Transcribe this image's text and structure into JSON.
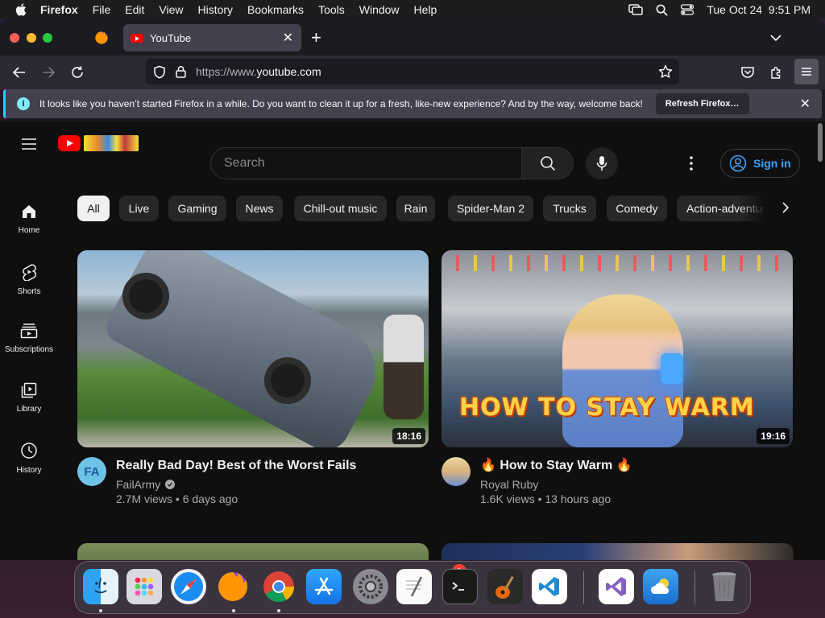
{
  "menubar": {
    "app": "Firefox",
    "items": [
      "File",
      "Edit",
      "View",
      "History",
      "Bookmarks",
      "Tools",
      "Window",
      "Help"
    ],
    "datetime": "Tue Oct 24  9:51 PM"
  },
  "browser": {
    "tab_title": "YouTube",
    "url_dim": "https://www.",
    "url_host": "youtube.com",
    "notification": {
      "message": "It looks like you haven’t started Firefox in a while. Do you want to clean it up for a fresh, like-new experience? And by the way, welcome back!",
      "button": "Refresh Firefox…"
    }
  },
  "youtube": {
    "search_placeholder": "Search",
    "sign_in": "Sign in",
    "guide": [
      {
        "label": "Home",
        "icon": "home-icon"
      },
      {
        "label": "Shorts",
        "icon": "shorts-icon"
      },
      {
        "label": "Subscriptions",
        "icon": "subscriptions-icon"
      },
      {
        "label": "Library",
        "icon": "library-icon"
      },
      {
        "label": "History",
        "icon": "history-icon"
      }
    ],
    "chips": [
      "All",
      "Live",
      "Gaming",
      "News",
      "Chill-out music",
      "Rain",
      "Spider-Man 2",
      "Trucks",
      "Comedy",
      "Action-adventure"
    ],
    "videos": [
      {
        "title": "Really Bad Day! Best of the Worst Fails",
        "channel": "FailArmy",
        "verified": true,
        "views": "2.7M views",
        "age": "6 days ago",
        "duration": "18:16",
        "avatar_text": "FA"
      },
      {
        "title": "How to Stay Warm",
        "title_prefix": "🔥",
        "title_suffix": "🔥",
        "channel": "Royal Ruby",
        "verified": false,
        "views": "1.6K views",
        "age": "13 hours ago",
        "duration": "19:16",
        "thumb_text": "HOW TO STAY WARM"
      }
    ]
  },
  "dock": {
    "apps": [
      "finder",
      "launchpad",
      "safari",
      "firefox",
      "chrome",
      "app-store",
      "system-settings",
      "textedit",
      "terminal",
      "garageband",
      "vscode",
      "visual-studio",
      "weather",
      "trash"
    ],
    "settings_badge": "1"
  },
  "colors": {
    "yt_bg": "#0f0f0f",
    "yt_red": "#ff0000",
    "link_blue": "#3ea6ff",
    "chip_bg": "#272727",
    "ff_toolbar": "#2b2a33"
  }
}
